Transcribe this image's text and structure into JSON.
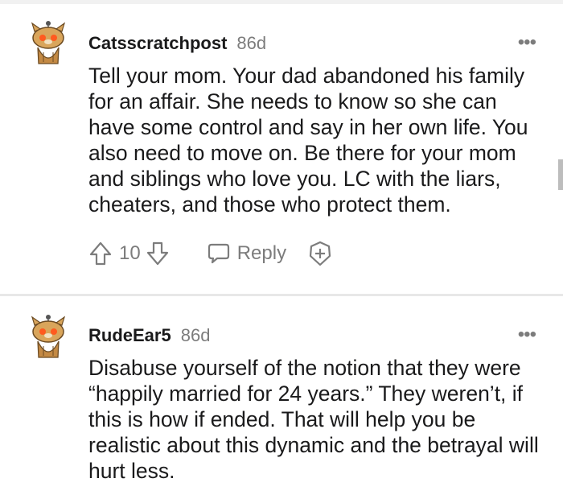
{
  "comments": [
    {
      "username": "Catsscratchpost",
      "age": "86d",
      "more": "•••",
      "text": "Tell your mom. Your dad abandoned his family for an affair. She needs to know so she can have some control and say in her own life. You also need to move on. Be there for your mom and siblings who love you. LC with the liars, cheaters, and those who protect them.",
      "votes": "10",
      "reply_label": "Reply"
    },
    {
      "username": "RudeEar5",
      "age": "86d",
      "more": "•••",
      "text": "Disabuse yourself of the notion that they were “happily married for 24 years.” They weren’t, if this is how if ended. That will help you be realistic about this dynamic and the betrayal will hurt less."
    }
  ],
  "icons": {
    "avatar": "reddit-snoo-avatar-icon",
    "upvote": "upvote-arrow-icon",
    "downvote": "downvote-arrow-icon",
    "reply": "speech-bubble-icon",
    "award": "award-plus-icon",
    "more": "more-options-icon"
  },
  "colors": {
    "text": "#1a1a1b",
    "meta": "#7c7c7c",
    "separator": "#e8e8e8"
  }
}
